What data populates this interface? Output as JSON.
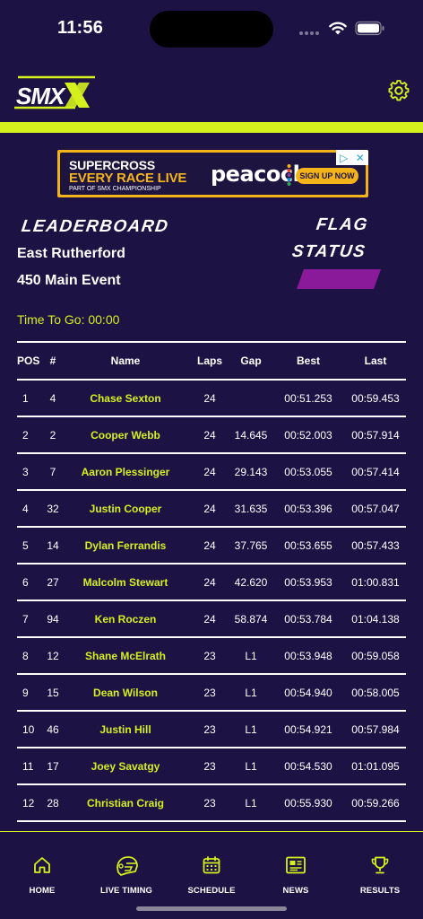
{
  "status_bar": {
    "time": "11:56"
  },
  "header": {
    "logo_text": "SMX"
  },
  "ad": {
    "line1": "SUPERCROSS",
    "line2": "EVERY RACE LIVE",
    "line3": "PART OF SMX CHAMPIONSHIP",
    "brand": "peacock",
    "cta": "SIGN UP NOW",
    "colors": {
      "frame": "#f3b41b",
      "background": "#1e1440"
    }
  },
  "race": {
    "leaderboard_title": "LEADERBOARD",
    "location": "East Rutherford",
    "event": "450 Main Event",
    "flag_title": "FLAG",
    "status_title": "STATUS",
    "flag_color": "#8a1a9a",
    "time_to_go": "Time To Go: 00:00"
  },
  "table": {
    "headers": {
      "pos": "POS",
      "num": "#",
      "name": "Name",
      "laps": "Laps",
      "gap": "Gap",
      "best": "Best",
      "last": "Last"
    },
    "rows": [
      {
        "pos": "1",
        "num": "4",
        "name": "Chase Sexton",
        "laps": "24",
        "gap": "",
        "best": "00:51.253",
        "last": "00:59.453"
      },
      {
        "pos": "2",
        "num": "2",
        "name": "Cooper Webb",
        "laps": "24",
        "gap": "14.645",
        "best": "00:52.003",
        "last": "00:57.914"
      },
      {
        "pos": "3",
        "num": "7",
        "name": "Aaron Plessinger",
        "laps": "24",
        "gap": "29.143",
        "best": "00:53.055",
        "last": "00:57.414"
      },
      {
        "pos": "4",
        "num": "32",
        "name": "Justin Cooper",
        "laps": "24",
        "gap": "31.635",
        "best": "00:53.396",
        "last": "00:57.047"
      },
      {
        "pos": "5",
        "num": "14",
        "name": "Dylan Ferrandis",
        "laps": "24",
        "gap": "37.765",
        "best": "00:53.655",
        "last": "00:57.433"
      },
      {
        "pos": "6",
        "num": "27",
        "name": "Malcolm Stewart",
        "laps": "24",
        "gap": "42.620",
        "best": "00:53.953",
        "last": "01:00.831"
      },
      {
        "pos": "7",
        "num": "94",
        "name": "Ken Roczen",
        "laps": "24",
        "gap": "58.874",
        "best": "00:53.784",
        "last": "01:04.138"
      },
      {
        "pos": "8",
        "num": "12",
        "name": "Shane McElrath",
        "laps": "23",
        "gap": "L1",
        "best": "00:53.948",
        "last": "00:59.058"
      },
      {
        "pos": "9",
        "num": "15",
        "name": "Dean Wilson",
        "laps": "23",
        "gap": "L1",
        "best": "00:54.940",
        "last": "00:58.005"
      },
      {
        "pos": "10",
        "num": "46",
        "name": "Justin Hill",
        "laps": "23",
        "gap": "L1",
        "best": "00:54.921",
        "last": "00:57.984"
      },
      {
        "pos": "11",
        "num": "17",
        "name": "Joey Savatgy",
        "laps": "23",
        "gap": "L1",
        "best": "00:54.530",
        "last": "01:01.095"
      },
      {
        "pos": "12",
        "num": "28",
        "name": "Christian Craig",
        "laps": "23",
        "gap": "L1",
        "best": "00:55.930",
        "last": "00:59.266"
      }
    ]
  },
  "tabs": [
    {
      "label": "HOME",
      "icon": "home-icon"
    },
    {
      "label": "LIVE TIMING",
      "icon": "helmet-icon"
    },
    {
      "label": "SCHEDULE",
      "icon": "calendar-icon"
    },
    {
      "label": "NEWS",
      "icon": "news-icon"
    },
    {
      "label": "RESULTS",
      "icon": "trophy-icon"
    }
  ],
  "colors": {
    "background": "#1c1244",
    "accent": "#d4f01d",
    "text": "#ffffff"
  }
}
